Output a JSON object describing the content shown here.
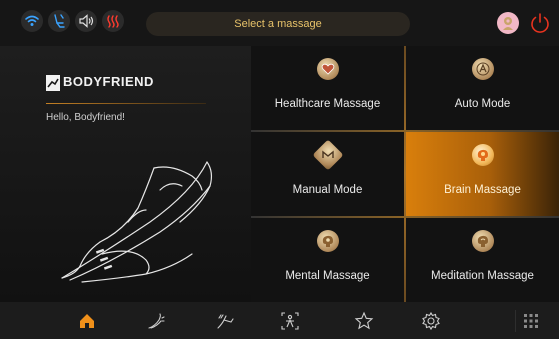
{
  "status_bar": {
    "title": "Select a massage",
    "icons": [
      "wifi-icon",
      "recline-icon",
      "volume-icon",
      "heat-icon"
    ],
    "right_icons": [
      "user-avatar-icon",
      "power-icon"
    ]
  },
  "sidebar": {
    "brand": "BODYFRIEND",
    "greeting": "Hello, Bodyfriend!"
  },
  "menu": {
    "items": [
      {
        "label": "Healthcare Massage",
        "icon": "heart-icon",
        "active": false
      },
      {
        "label": "Auto Mode",
        "icon": "auto-a-icon",
        "active": false
      },
      {
        "label": "Manual Mode",
        "icon": "manual-m-icon",
        "active": false
      },
      {
        "label": "Brain Massage",
        "icon": "brain-icon",
        "active": true
      },
      {
        "label": "Mental Massage",
        "icon": "mental-head-icon",
        "active": false
      },
      {
        "label": "Meditation Massage",
        "icon": "meditation-head-icon",
        "active": false
      }
    ]
  },
  "bottom_nav": {
    "items": [
      "home-icon",
      "chair-recline-icon",
      "chair-stretch-icon",
      "body-scan-icon",
      "favorite-star-icon",
      "settings-icon",
      "apps-grid-icon"
    ],
    "active": "home-icon"
  },
  "colors": {
    "accent": "#e8901a",
    "accent_dark": "#a85f0a",
    "title_text": "#e8c36a",
    "background": "#0d0d0d"
  }
}
